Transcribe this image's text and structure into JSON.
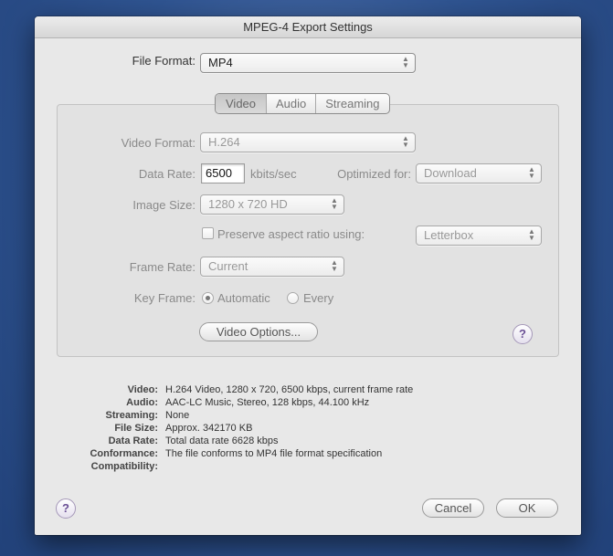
{
  "window": {
    "title": "MPEG-4 Export Settings"
  },
  "file_format": {
    "label": "File Format:",
    "value": "MP4"
  },
  "tabs": [
    {
      "label": "Video",
      "active": true
    },
    {
      "label": "Audio",
      "active": false
    },
    {
      "label": "Streaming",
      "active": false
    }
  ],
  "video": {
    "format_label": "Video Format:",
    "format_value": "H.264",
    "data_rate_label": "Data Rate:",
    "data_rate_value": "6500",
    "data_rate_unit": "kbits/sec",
    "optimized_label": "Optimized for:",
    "optimized_value": "Download",
    "image_size_label": "Image Size:",
    "image_size_value": "1280 x 720 HD",
    "preserve_label": "Preserve aspect ratio using:",
    "preserve_checked": false,
    "preserve_value": "Letterbox",
    "frame_rate_label": "Frame Rate:",
    "frame_rate_value": "Current",
    "key_frame_label": "Key Frame:",
    "key_frame_automatic": "Automatic",
    "key_frame_every": "Every",
    "options_button": "Video Options..."
  },
  "summary": [
    {
      "key": "Video:",
      "value": "H.264 Video, 1280 x 720, 6500 kbps, current frame rate"
    },
    {
      "key": "Audio:",
      "value": "AAC-LC Music, Stereo, 128 kbps, 44.100 kHz"
    },
    {
      "key": "Streaming:",
      "value": "None"
    },
    {
      "key": "File Size:",
      "value": "Approx. 342170 KB"
    },
    {
      "key": "Data Rate:",
      "value": "Total data rate 6628 kbps"
    },
    {
      "key": "Conformance:",
      "value": "The file conforms to MP4 file format specification"
    },
    {
      "key": "Compatibility:",
      "value": ""
    }
  ],
  "buttons": {
    "cancel": "Cancel",
    "ok": "OK",
    "help": "?"
  }
}
